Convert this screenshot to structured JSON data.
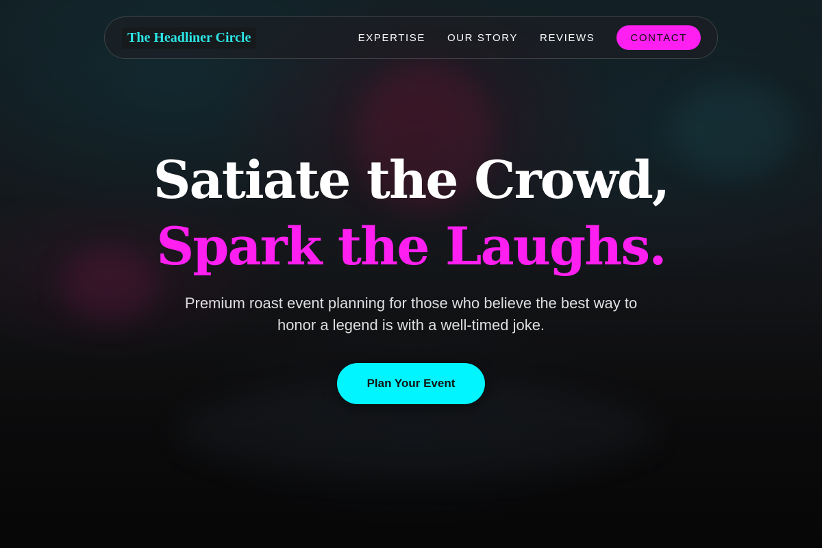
{
  "nav": {
    "logo": "The Headliner Circle",
    "links": [
      "EXPERTISE",
      "OUR STORY",
      "REVIEWS"
    ],
    "contact_label": "CONTACT"
  },
  "hero": {
    "headline_line1": "Satiate the Crowd,",
    "headline_line2": "Spark the Laughs.",
    "subtitle": "Premium roast event planning for those who believe the best way to honor a legend is with a well-timed joke.",
    "cta_label": "Plan Your Event"
  },
  "colors": {
    "accent_magenta": "#ff1ff0",
    "accent_cyan": "#00f5ff",
    "logo_text": "#2ee6e6",
    "headline_white": "#ffffff"
  }
}
